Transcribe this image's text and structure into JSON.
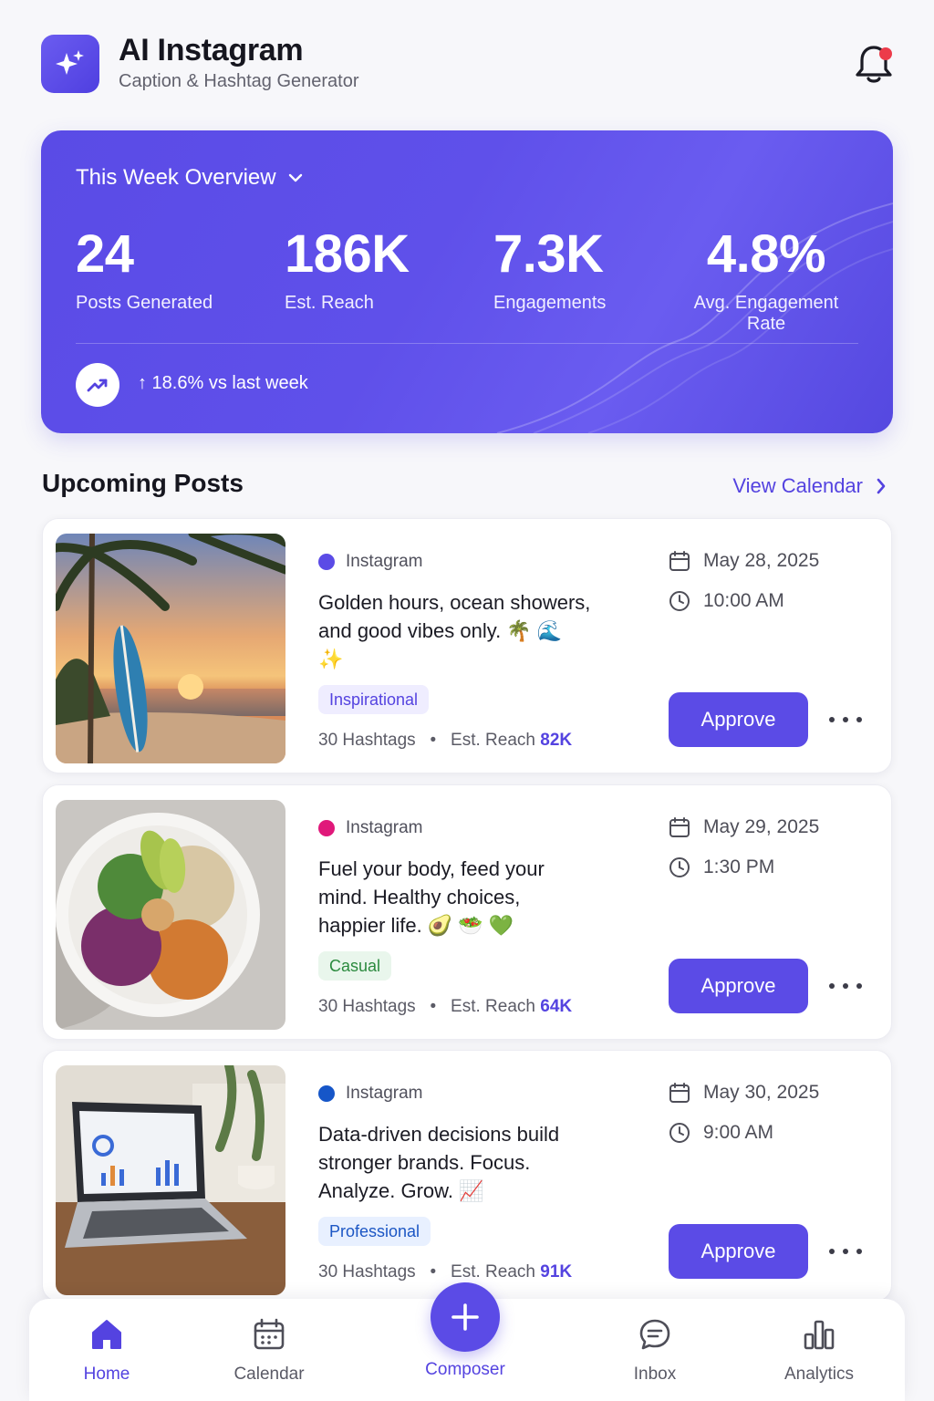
{
  "header": {
    "title": "AI Instagram",
    "subtitle": "Caption & Hashtag Generator",
    "logo_icon": "sparkle-icon",
    "notification_icon": "bell-icon"
  },
  "overview": {
    "title": "This Week Overview",
    "stats": [
      {
        "value": "24",
        "label": "Posts Generated"
      },
      {
        "value": "186K",
        "label": "Est. Reach"
      },
      {
        "value": "7.3K",
        "label": "Engagements"
      },
      {
        "value": "4.8%",
        "label": "Avg. Engagement Rate"
      }
    ],
    "trend_text": "↑ 18.6% vs last week"
  },
  "upcoming": {
    "title": "Upcoming Posts",
    "view_calendar": "View Calendar"
  },
  "posts": [
    {
      "platform": "Instagram",
      "dot_color": "#5b4be6",
      "caption": "Golden hours, ocean showers, and good vibes only. 🌴 🌊 ✨",
      "tag": "Inspirational",
      "hashtags": "30 Hashtags",
      "reach_label": "Est. Reach",
      "reach_value": "82K",
      "date": "May 28, 2025",
      "time": "10:00 AM",
      "approve": "Approve",
      "image": "beach-sunset-surfboard"
    },
    {
      "platform": "Instagram",
      "dot_color": "#e0187a",
      "caption": "Fuel your body, feed your mind. Healthy choices, happier life. 🥑 🥗 💚",
      "tag": "Casual",
      "hashtags": "30 Hashtags",
      "reach_label": "Est. Reach",
      "reach_value": "64K",
      "date": "May 29, 2025",
      "time": "1:30 PM",
      "approve": "Approve",
      "image": "healthy-food-bowl"
    },
    {
      "platform": "Instagram",
      "dot_color": "#1656c8",
      "caption": "Data-driven decisions build stronger brands. Focus. Analyze. Grow. 📈",
      "tag": "Professional",
      "hashtags": "30 Hashtags",
      "reach_label": "Est. Reach",
      "reach_value": "91K",
      "date": "May 30, 2025",
      "time": "9:00 AM",
      "approve": "Approve",
      "image": "laptop-analytics-dashboard"
    }
  ],
  "nav": {
    "home": "Home",
    "calendar": "Calendar",
    "composer": "Composer",
    "inbox": "Inbox",
    "analytics": "Analytics"
  },
  "colors": {
    "accent": "#5b4be6",
    "tag_inspirational_bg": "#efedff",
    "tag_casual_bg": "#e9f6ec",
    "tag_professional_bg": "#e8f0ff"
  }
}
